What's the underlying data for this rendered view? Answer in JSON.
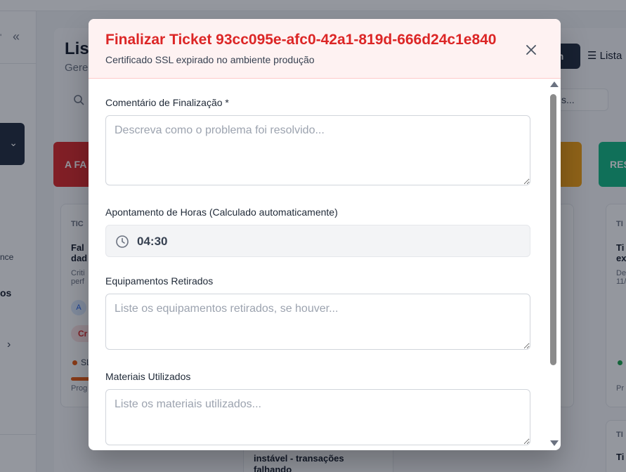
{
  "background": {
    "page_title": "Lis",
    "page_subtitle": "Gere",
    "view_kanban_label": "an",
    "view_list_label": "Lista",
    "filter_label": "s...",
    "column_todo_label": "A FA",
    "column_done_label": "RES",
    "sidebar_text_1": "nce",
    "sidebar_text_2": "os",
    "card_left_label": "TIC",
    "card_left_title": "Fal dad",
    "card_left_desc": "Criti perf",
    "card_left_badge": "Cr",
    "card_left_sla": "SL",
    "card_left_progress": "Prog",
    "card_right_label": "TI",
    "card_right_title": "Ti ex",
    "card_right_desc": "De 11/",
    "card_right_progress": "Pr",
    "card_bottom_text_1": "instável - transações",
    "card_bottom_text_2": "falhando",
    "card_br_label": "TI",
    "card_br_title": "Ti"
  },
  "modal": {
    "title": "Finalizar Ticket 93cc095e-afc0-42a1-819d-666d24c1e840",
    "subtitle": "Certificado SSL expirado no ambiente produção",
    "close_icon": "close-icon",
    "fields": {
      "comment": {
        "label": "Comentário de Finalização *",
        "placeholder": "Descreva como o problema foi resolvido...",
        "value": ""
      },
      "hours": {
        "label": "Apontamento de Horas (Calculado automaticamente)",
        "value": "04:30",
        "icon": "clock-icon"
      },
      "equipment": {
        "label": "Equipamentos Retirados",
        "placeholder": "Liste os equipamentos retirados, se houver...",
        "value": ""
      },
      "materials": {
        "label": "Materiais Utilizados",
        "placeholder": "Liste os materiais utilizados...",
        "value": ""
      }
    }
  },
  "colors": {
    "accent_red": "#dc2626",
    "header_bg": "#fef2f2",
    "overlay": "rgba(17,24,39,0.45)"
  }
}
